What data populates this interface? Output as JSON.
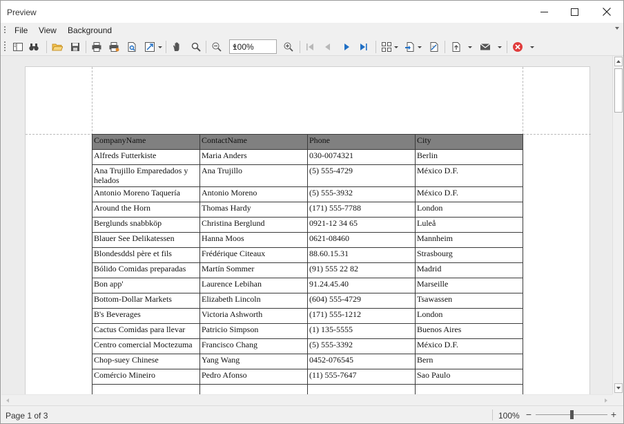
{
  "window": {
    "title": "Preview"
  },
  "menu": [
    {
      "label": "File"
    },
    {
      "label": "View"
    },
    {
      "label": "Background"
    }
  ],
  "toolbar": {
    "zoom_value": "100%"
  },
  "report": {
    "columns": [
      "CompanyName",
      "ContactName",
      "Phone",
      "City"
    ],
    "rows": [
      [
        "Alfreds Futterkiste",
        "Maria Anders",
        "030-0074321",
        "Berlin"
      ],
      [
        "Ana Trujillo Emparedados y helados",
        "Ana Trujillo",
        "(5) 555-4729",
        "México D.F."
      ],
      [
        "Antonio Moreno Taquería",
        "Antonio Moreno",
        "(5) 555-3932",
        "México D.F."
      ],
      [
        "Around the Horn",
        "Thomas Hardy",
        "(171) 555-7788",
        "London"
      ],
      [
        "Berglunds snabbköp",
        "Christina Berglund",
        "0921-12 34 65",
        "Luleå"
      ],
      [
        "Blauer See Delikatessen",
        "Hanna Moos",
        "0621-08460",
        "Mannheim"
      ],
      [
        "Blondesddsl père et fils",
        "Frédérique Citeaux",
        "88.60.15.31",
        "Strasbourg"
      ],
      [
        "Bólido Comidas preparadas",
        "Martín Sommer",
        "(91) 555 22 82",
        "Madrid"
      ],
      [
        "Bon app'",
        "Laurence Lebihan",
        "91.24.45.40",
        "Marseille"
      ],
      [
        "Bottom-Dollar Markets",
        "Elizabeth Lincoln",
        "(604) 555-4729",
        "Tsawassen"
      ],
      [
        "B's Beverages",
        "Victoria Ashworth",
        "(171) 555-1212",
        "London"
      ],
      [
        "Cactus Comidas para llevar",
        "Patricio Simpson",
        "(1) 135-5555",
        "Buenos Aires"
      ],
      [
        "Centro comercial Moctezuma",
        "Francisco Chang",
        "(5) 555-3392",
        "México D.F."
      ],
      [
        "Chop-suey Chinese",
        "Yang Wang",
        "0452-076545",
        "Bern"
      ],
      [
        "Comércio Mineiro",
        "Pedro Afonso",
        "(11) 555-7647",
        "Sao Paulo"
      ],
      [
        "",
        "",
        "",
        ""
      ]
    ]
  },
  "status": {
    "page_info": "Page 1 of 3",
    "zoom": "100%",
    "zoom_minus": "−",
    "zoom_plus": "+",
    "zoom_level": 0.5
  },
  "colors": {
    "header_fill": "#808080",
    "accent": "#1f6fc5",
    "close_red": "#e03c3c"
  }
}
